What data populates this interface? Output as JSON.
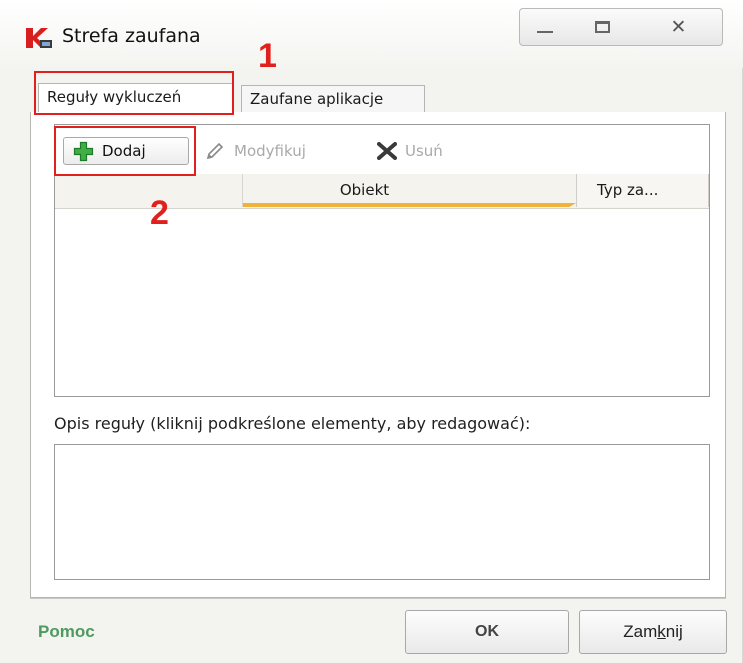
{
  "window": {
    "title": "Strefa zaufana",
    "icon": "kaspersky-k-icon",
    "controls": {
      "minimize": "minimize-icon",
      "maximize": "maximize-icon",
      "close": "close-icon"
    }
  },
  "annotations": {
    "marker_1": "1",
    "marker_2": "2",
    "highlight_color": "#e0201c"
  },
  "tabs": [
    {
      "label": "Reguły wykluczeń",
      "selected": true
    },
    {
      "label": "Zaufane aplikacje",
      "selected": false
    }
  ],
  "toolbar": {
    "add_label": "Dodaj",
    "edit_label": "Modyfikuj",
    "delete_label": "Usuń",
    "add_icon": "plus-icon",
    "edit_icon": "pencil-icon",
    "delete_icon": "x-icon"
  },
  "table": {
    "columns": [
      "",
      "Obiekt",
      "Typ za..."
    ],
    "rows": []
  },
  "description": {
    "label": "Opis reguły (kliknij podkreślone elementy, aby redagować):",
    "value": ""
  },
  "footer": {
    "help_label": "Pomoc",
    "ok_label": "OK",
    "close_label": "Zamknij",
    "close_accel_before": "Zam",
    "close_accel_key": "k",
    "close_accel_after": "nij"
  },
  "colors": {
    "accent_green": "#4f9a5f",
    "sort_underline": "#f0b33a",
    "plus_green": "#2e9a3a"
  }
}
